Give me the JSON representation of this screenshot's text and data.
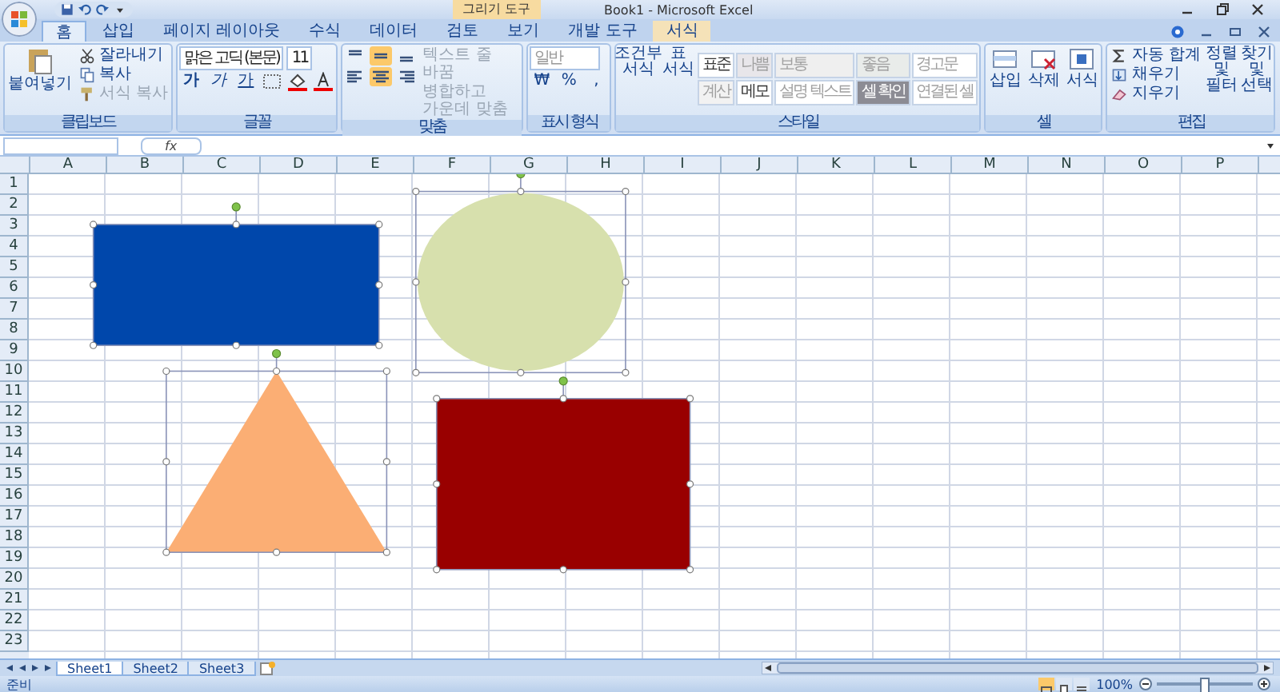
{
  "title_bar": {
    "title": "Book1 - Microsoft Excel",
    "contextual_tab": "그리기 도구"
  },
  "tabs": [
    {
      "label": "홈",
      "selected": true,
      "kind": "standard"
    },
    {
      "label": "삽입",
      "selected": false,
      "kind": "standard"
    },
    {
      "label": "페이지 레이아웃",
      "selected": false,
      "kind": "standard"
    },
    {
      "label": "수식",
      "selected": false,
      "kind": "standard"
    },
    {
      "label": "데이터",
      "selected": false,
      "kind": "standard"
    },
    {
      "label": "검토",
      "selected": false,
      "kind": "standard"
    },
    {
      "label": "보기",
      "selected": false,
      "kind": "standard"
    },
    {
      "label": "개발 도구",
      "selected": false,
      "kind": "standard"
    },
    {
      "label": "서식",
      "selected": false,
      "kind": "contextual"
    }
  ],
  "ribbon": {
    "clipboard": {
      "label": "클립보드",
      "paste": "붙여넣기",
      "items": [
        {
          "label": "잘라내기",
          "kind": "cut",
          "disabled": false
        },
        {
          "label": "복사",
          "kind": "copy",
          "disabled": false
        },
        {
          "label": "서식 복사",
          "kind": "brush",
          "disabled": true
        }
      ]
    },
    "font": {
      "label": "글꼴",
      "font_name": "맑은 고딕 (본문)",
      "font_size": "11",
      "style_buttons": [
        {
          "label": "가",
          "kind": "bold"
        },
        {
          "label": "가",
          "kind": "italic"
        },
        {
          "label": "가",
          "kind": "underline"
        }
      ]
    },
    "alignment": {
      "label": "맞춤",
      "buttons": [
        {
          "kind": "top",
          "selected": false
        },
        {
          "kind": "middle",
          "selected": true
        },
        {
          "kind": "bottom",
          "selected": false
        },
        {
          "kind": "left",
          "selected": false
        },
        {
          "kind": "center",
          "selected": true
        },
        {
          "kind": "right",
          "selected": false
        }
      ],
      "wrap_text": "텍스트 줄 바꿈",
      "merge_center": "병합하고 가운데 맞춤"
    },
    "number": {
      "label": "표시 형식",
      "format": "일반",
      "buttons": [
        "₩",
        "%",
        ","
      ]
    },
    "styles": {
      "label": "스타일",
      "conditional_format": "조건부 서식",
      "format_table": "표 서식",
      "cells": [
        {
          "label": "표준",
          "disabled": false,
          "color": "#ffffff"
        },
        {
          "label": "나쁨",
          "disabled": true,
          "color": "#e8e6ea"
        },
        {
          "label": "보통",
          "disabled": true,
          "color": "#efefef"
        },
        {
          "label": "좋음",
          "disabled": true,
          "color": "#e9ecea"
        },
        {
          "label": "경고문",
          "disabled": true,
          "color": "#ffffff"
        },
        {
          "label": "계산",
          "disabled": true,
          "color": "#f2f2f2"
        },
        {
          "label": "메모",
          "disabled": false,
          "color": "#ffffff"
        },
        {
          "label": "설명 텍스트",
          "disabled": true,
          "color": "#ffffff"
        },
        {
          "label": "셀 확인",
          "disabled": false,
          "color": "#8c8c94"
        },
        {
          "label": "연결된 셀",
          "disabled": true,
          "color": "#ffffff"
        }
      ]
    },
    "cells": {
      "label": "셀",
      "buttons": [
        {
          "label": "삽입",
          "kind": "insert"
        },
        {
          "label": "삭제",
          "kind": "delete"
        },
        {
          "label": "서식",
          "kind": "format"
        }
      ]
    },
    "editing": {
      "label": "편집",
      "items": [
        {
          "label": "자동 합계",
          "kind": "sum"
        },
        {
          "label": "채우기",
          "kind": "fill"
        },
        {
          "label": "지우기",
          "kind": "clear"
        }
      ],
      "sort_filter": "정렬 및 필터",
      "find_select": "찾기 및 선택"
    }
  },
  "formula_bar": {
    "function_label": "fx"
  },
  "columns": [
    "A",
    "B",
    "C",
    "D",
    "E",
    "F",
    "G",
    "H",
    "I",
    "J",
    "K",
    "L",
    "M",
    "N",
    "O",
    "P"
  ],
  "rows": [
    "1",
    "2",
    "3",
    "4",
    "5",
    "6",
    "7",
    "8",
    "9",
    "10",
    "11",
    "12",
    "13",
    "14",
    "15",
    "16",
    "17",
    "18",
    "19",
    "20",
    "21",
    "22",
    "23"
  ],
  "shapes": [
    {
      "kind": "rectangle",
      "color": "#0047ab",
      "selected": true
    },
    {
      "kind": "ellipse",
      "color": "#d7e0ad",
      "selected": true
    },
    {
      "kind": "triangle",
      "color": "#fbae74",
      "selected": true
    },
    {
      "kind": "rectangle",
      "color": "#990000",
      "selected": true
    }
  ],
  "sheet_tabs": [
    {
      "label": "Sheet1",
      "selected": true
    },
    {
      "label": "Sheet2",
      "selected": false
    },
    {
      "label": "Sheet3",
      "selected": false
    }
  ],
  "status_bar": {
    "text": "준비",
    "zoom": "100%",
    "zoom_slider": {
      "level": 0.5
    },
    "views": [
      {
        "kind": "normal",
        "selected": true
      },
      {
        "kind": "layout",
        "selected": false
      },
      {
        "kind": "page_break",
        "selected": false
      }
    ]
  }
}
